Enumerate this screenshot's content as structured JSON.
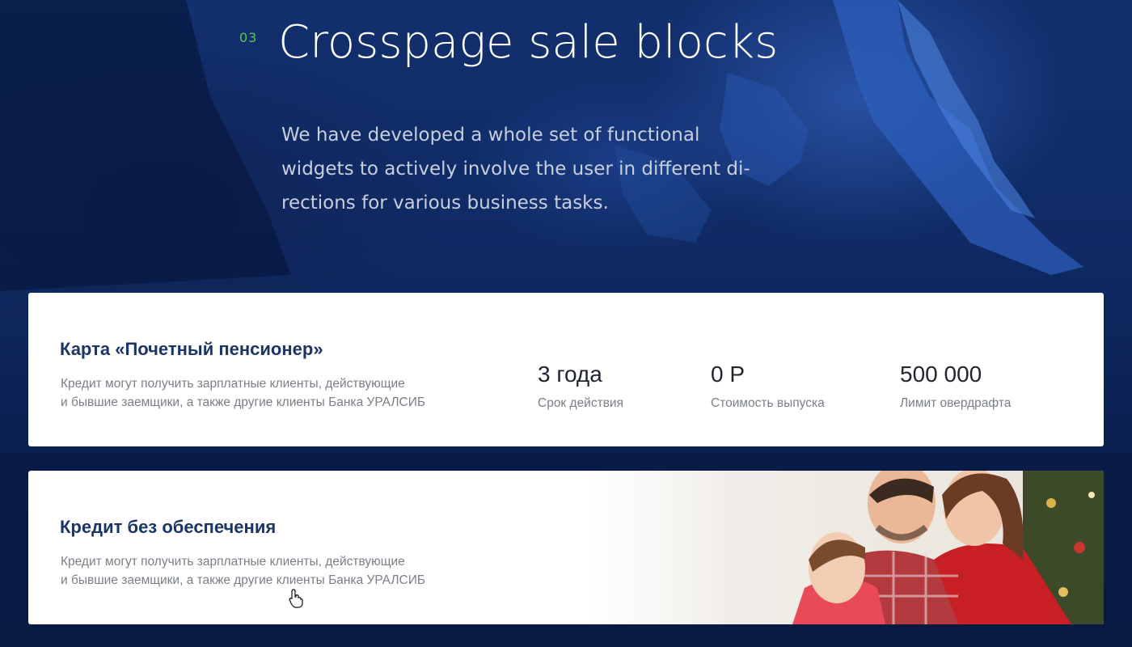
{
  "section": {
    "number": "03",
    "title": "Crosspage sale blocks",
    "description": "We have developed a whole set of functional\nwidgets to actively involve the user in different di-\nrections for various business tasks."
  },
  "cards": [
    {
      "title": "Карта «Почетный пенсионер»",
      "description": "Кредит могут получить зарплатные клиенты, действующие\nи бывшие заемщики, а также другие клиенты Банка УРАЛСИБ",
      "stats": [
        {
          "value": "3 года",
          "label": "Срок действия"
        },
        {
          "value": "0 Р",
          "label": "Стоимость выпуска"
        },
        {
          "value": "500 000",
          "label": "Лимит овердрафта"
        }
      ]
    },
    {
      "title": "Кредит без обеспечения",
      "description": "Кредит могут получить зарплатные клиенты, действующие\nи бывшие заемщики, а также другие клиенты Банка УРАЛСИБ",
      "image": "family-christmas-photo"
    }
  ],
  "colors": {
    "background": "#0b2050",
    "section_number": "#5cc25c",
    "card_title": "#1b3566",
    "muted_text": "#7a7f87"
  },
  "icons": {
    "cursor": "hand-pointer-icon"
  }
}
